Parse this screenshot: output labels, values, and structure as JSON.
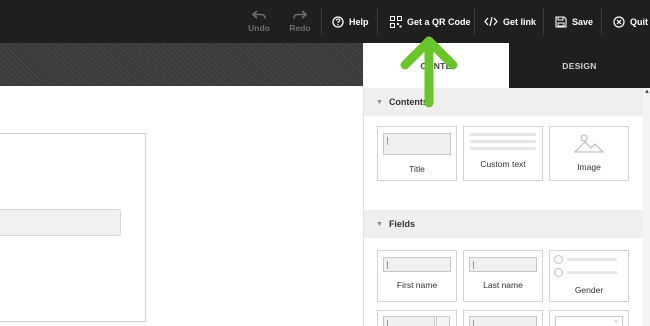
{
  "toolbar": {
    "undo_label": "Undo",
    "redo_label": "Redo",
    "help_label": "Help",
    "qr_label": "Get a QR Code",
    "link_label": "Get link",
    "save_label": "Save",
    "quit_label": "Quit"
  },
  "tabs": {
    "content_label": "CONTE",
    "design_label": "DESIGN"
  },
  "sections": {
    "contents_title": "Contents",
    "fields_title": "Fields"
  },
  "content_tiles": {
    "title_label": "Title",
    "custom_text_label": "Custom text",
    "image_label": "Image"
  },
  "field_tiles": {
    "first_name_label": "First name",
    "last_name_label": "Last name",
    "gender_label": "Gender"
  },
  "colors": {
    "toolbar_bg": "#1f1f1f",
    "arrow_green": "#6ac42b"
  }
}
